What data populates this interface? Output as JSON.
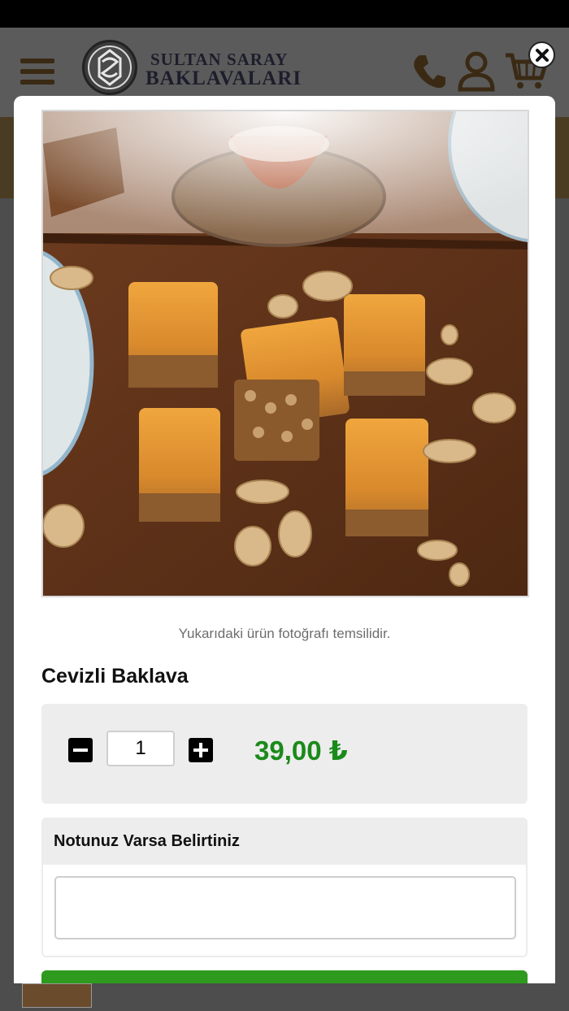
{
  "header": {
    "logo_line1": "SULTAN SARAY",
    "logo_line2": "BAKLAVALARI",
    "icons": [
      "menu-icon",
      "phone-icon",
      "user-icon",
      "cart-icon"
    ]
  },
  "modal": {
    "close_icon": "close-icon",
    "photo_note": "Yukarıdaki ürün fotoğrafı temsilidir.",
    "product_name": "Cevizli Baklava",
    "quantity": "1",
    "price": "39,00 ₺",
    "note_title": "Notunuz Varsa Belirtiniz",
    "note_value": ""
  },
  "colors": {
    "price": "#1a8a1a",
    "add_button": "#2e9a1e",
    "brand_dark": "#3a2a14"
  }
}
